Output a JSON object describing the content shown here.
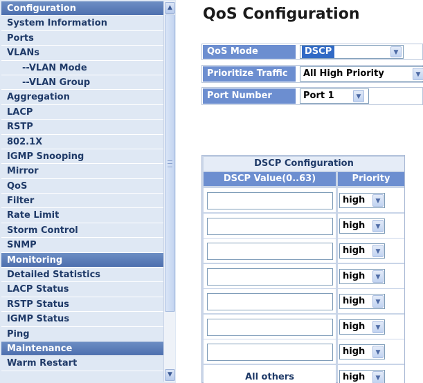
{
  "sidebar": {
    "items": [
      {
        "label": "Configuration",
        "kind": "header"
      },
      {
        "label": "System Information",
        "kind": "item"
      },
      {
        "label": "Ports",
        "kind": "item"
      },
      {
        "label": "VLANs",
        "kind": "item"
      },
      {
        "label": "--VLAN Mode",
        "kind": "sub"
      },
      {
        "label": "--VLAN Group",
        "kind": "sub"
      },
      {
        "label": "Aggregation",
        "kind": "item"
      },
      {
        "label": "LACP",
        "kind": "item"
      },
      {
        "label": "RSTP",
        "kind": "item"
      },
      {
        "label": "802.1X",
        "kind": "item"
      },
      {
        "label": "IGMP Snooping",
        "kind": "item"
      },
      {
        "label": "Mirror",
        "kind": "item"
      },
      {
        "label": "QoS",
        "kind": "item"
      },
      {
        "label": "Filter",
        "kind": "item"
      },
      {
        "label": "Rate Limit",
        "kind": "item"
      },
      {
        "label": "Storm Control",
        "kind": "item"
      },
      {
        "label": "SNMP",
        "kind": "item"
      },
      {
        "label": "Monitoring",
        "kind": "header"
      },
      {
        "label": "Detailed Statistics",
        "kind": "item"
      },
      {
        "label": "LACP Status",
        "kind": "item"
      },
      {
        "label": "RSTP Status",
        "kind": "item"
      },
      {
        "label": "IGMP Status",
        "kind": "item"
      },
      {
        "label": "Ping",
        "kind": "item"
      },
      {
        "label": "Maintenance",
        "kind": "header"
      },
      {
        "label": "Warm Restart",
        "kind": "item"
      }
    ],
    "scroll_up_glyph": "▲",
    "scroll_down_glyph": "▼"
  },
  "main": {
    "title": "QoS Configuration",
    "qos_mode": {
      "label": "QoS Mode",
      "value": "DSCP"
    },
    "prioritize_traffic": {
      "label": "Prioritize Traffic",
      "value": "All High Priority"
    },
    "port_number": {
      "label": "Port Number",
      "value": "Port 1"
    },
    "dropdown_glyph": "▼",
    "dscp": {
      "title": "DSCP Configuration",
      "col_value": "DSCP Value(0..63)",
      "col_priority": "Priority",
      "rows": [
        {
          "value": "",
          "priority": "high"
        },
        {
          "value": "",
          "priority": "high"
        },
        {
          "value": "",
          "priority": "high"
        },
        {
          "value": "",
          "priority": "high"
        },
        {
          "value": "",
          "priority": "high"
        },
        {
          "value": "",
          "priority": "high"
        },
        {
          "value": "",
          "priority": "high"
        }
      ],
      "others_label": "All others",
      "others_priority": "high"
    }
  },
  "colors": {
    "sidebar_bg": "#dfe8f4",
    "header_bg": "#5a7dbc",
    "label_bg": "#6c8ed0",
    "text": "#1f3a68"
  }
}
